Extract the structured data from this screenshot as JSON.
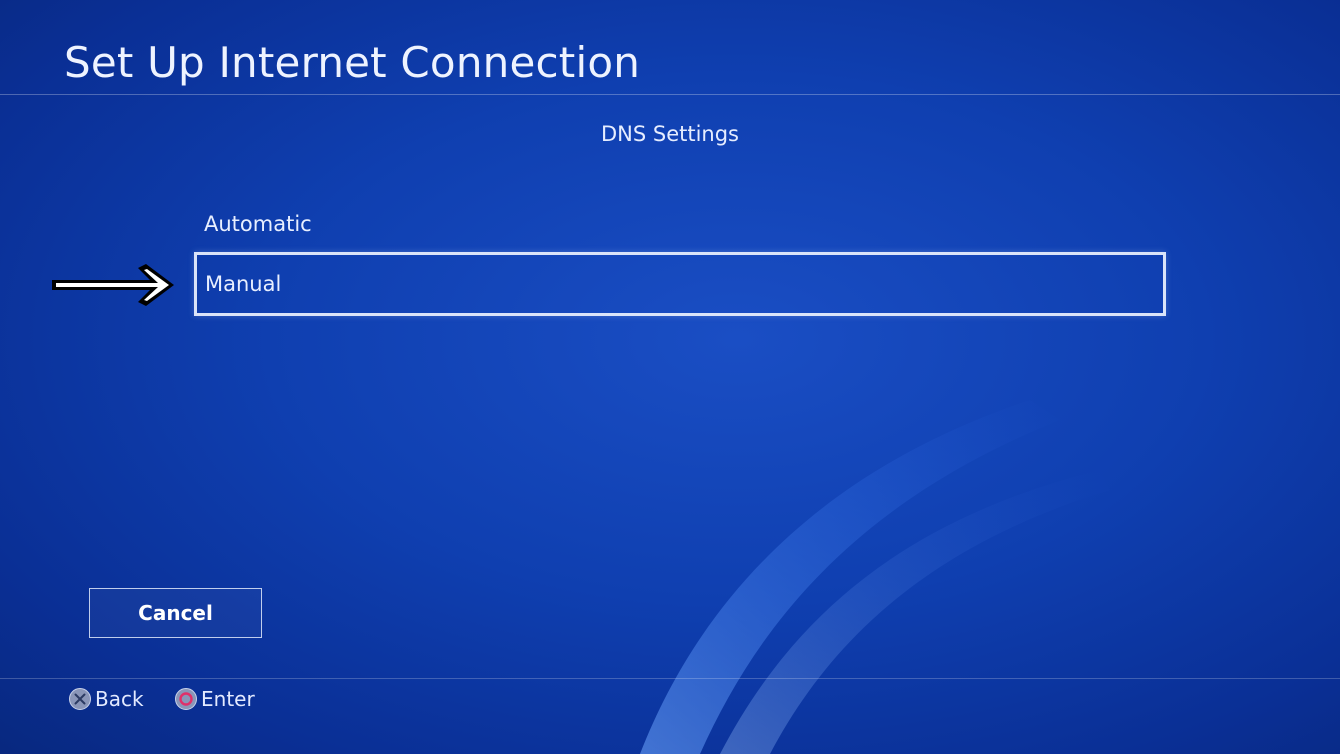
{
  "header": {
    "title": "Set Up Internet Connection"
  },
  "screen": {
    "subtitle": "DNS Settings"
  },
  "menu": {
    "items": [
      {
        "label": "Automatic",
        "selected": false
      },
      {
        "label": "Manual",
        "selected": true
      }
    ]
  },
  "actions": {
    "cancel_label": "Cancel"
  },
  "footer": {
    "back_label": "Back",
    "back_icon": "cross-button-icon",
    "enter_label": "Enter",
    "enter_icon": "circle-button-icon"
  },
  "colors": {
    "background": "#0f3fb0",
    "highlight_border": "#ebf2ff",
    "circle_button": "#e0306a"
  }
}
